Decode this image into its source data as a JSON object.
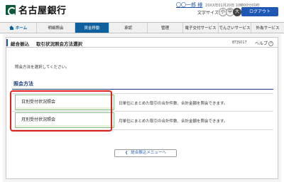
{
  "header": {
    "bank_name": "名古屋銀行",
    "user_name": "〇〇一郎 様",
    "last_login": "20XX年01月20日 10時00分00秒",
    "font_size_label": "文字サイズ",
    "font_size_options": [
      "小",
      "中",
      "大"
    ],
    "selected_font_size": "大",
    "logout_label": "ログアウト"
  },
  "nav": {
    "items": [
      {
        "label": "ホーム"
      },
      {
        "label": "明細照会"
      },
      {
        "label": "資金移動"
      },
      {
        "label": "承認"
      },
      {
        "label": "管理"
      },
      {
        "label": "電子交付サービス"
      },
      {
        "label": "でんさいサービス"
      },
      {
        "label": "外為サービス"
      }
    ],
    "active": "資金移動"
  },
  "page": {
    "category": "総合振込",
    "title": "取引状況照会方法選択",
    "screen_id": "BTJS017",
    "help_label": "ヘルプ",
    "help_icon_glyph": "?",
    "instruction": "照会方法を選択してください。",
    "section_title": "照会方法",
    "options": [
      {
        "label": "日別受付状況照会",
        "description": "日単位にまとめた取引の合計件数、合計金額を照会できます。"
      },
      {
        "label": "月別受付状況照会",
        "description": "月単位にまとめた取引の合計件数、合計金額を照会できます。"
      }
    ],
    "back_label": "総合振込メニューへ"
  },
  "colors": {
    "brand_green": "#0c5a3a",
    "nav_active": "#0d5f9e",
    "logout_blue": "#1f57b5",
    "highlight_red": "#e0201b",
    "section_navy": "#1a3f7a"
  }
}
